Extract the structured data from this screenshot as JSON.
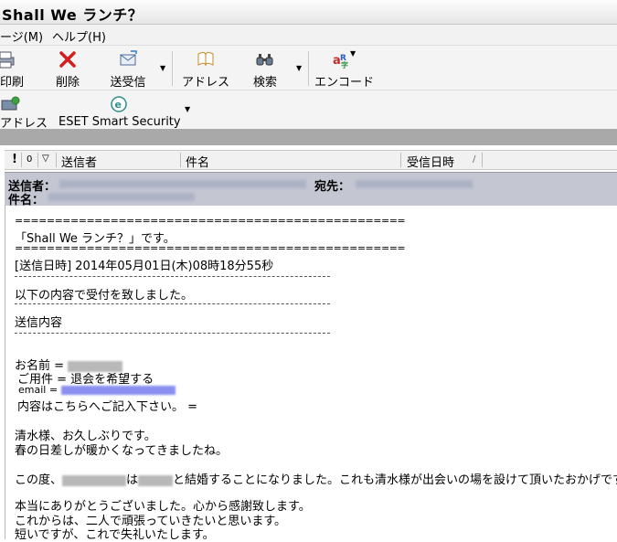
{
  "window": {
    "title": "Shall We ランチ？"
  },
  "menu": {
    "items": [
      "ージ(M)",
      "ヘルプ(H)"
    ]
  },
  "toolbar1": {
    "print": "印刷",
    "delete": "削除",
    "send_recv": "送受信",
    "address": "アドレス",
    "search": "検索",
    "encode": "エンコード"
  },
  "toolbar2": {
    "address": "アドレス",
    "eset": "ESET Smart Security"
  },
  "list": {
    "col_sender": "送信者",
    "col_subject": "件名",
    "col_date": "受信日時",
    "flag_excl": "!",
    "flag_clip": "0",
    "flag_mark": "▽",
    "sort_indicator": "/"
  },
  "message": {
    "label_from": "送信者：",
    "label_to": "宛先：",
    "label_subject": "件名：",
    "separator": "=================================================",
    "subject_line": "「Shall We ランチ？」です。",
    "sent_at": "[送信日時] 2014年05月01日(木)08時18分55秒",
    "received_notice": "以下の内容で受付を致しました。",
    "contents_heading": "送信内容",
    "name_label": "お名前 =",
    "purpose": "ご用件 = 退会を希望する",
    "email_label": "email =",
    "content_label": "内容はこちらへご記入下さい。 =",
    "p1_l1": "清水様、お久しぶりです。",
    "p1_l2": "春の日差しが暖かくなってきましたね。",
    "p2_pre": "この度、",
    "p2_mid": "は",
    "p2_post": "と結婚することになりました。これも清水様が出会いの場を設けて頂いたおかげです。",
    "p3_l1": "本当にありがとうございました。心から感謝致します。",
    "p3_l2": "これからは、二人で頑張っていきたいと思います。",
    "p3_l3": "短いですが、これで失礼いたします。"
  }
}
